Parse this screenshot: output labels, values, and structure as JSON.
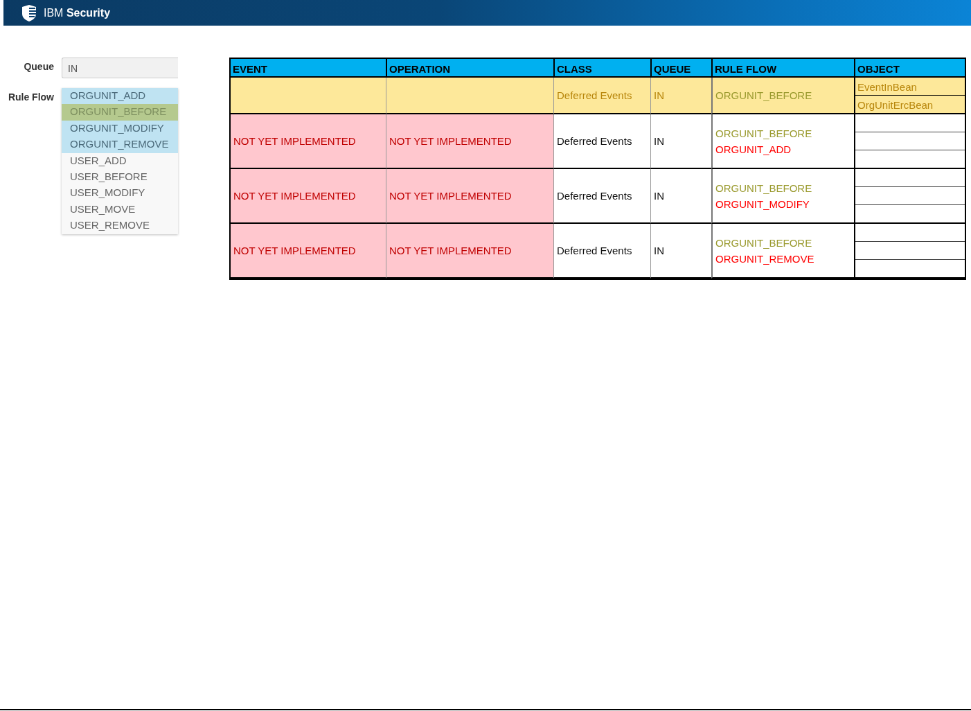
{
  "header": {
    "brand": "IBM **Security**"
  },
  "form": {
    "queue": {
      "label": "Queue",
      "value": "IN"
    },
    "rule_flow": {
      "label": "Rule Flow",
      "options": [
        {
          "label": "ORGUNIT_ADD",
          "selected": true,
          "active": false
        },
        {
          "label": "ORGUNIT_BEFORE",
          "selected": true,
          "active": true
        },
        {
          "label": "ORGUNIT_MODIFY",
          "selected": true,
          "active": false
        },
        {
          "label": "ORGUNIT_REMOVE",
          "selected": true,
          "active": false
        },
        {
          "label": "USER_ADD",
          "selected": false,
          "active": false
        },
        {
          "label": "USER_BEFORE",
          "selected": false,
          "active": false
        },
        {
          "label": "USER_MODIFY",
          "selected": false,
          "active": false
        },
        {
          "label": "USER_MOVE",
          "selected": false,
          "active": false
        },
        {
          "label": "USER_REMOVE",
          "selected": false,
          "active": false
        }
      ]
    }
  },
  "table": {
    "columns": [
      "EVENT",
      "OPERATION",
      "CLASS",
      "QUEUE",
      "RULE FLOW",
      "OBJECT"
    ],
    "rows": [
      {
        "kind": "configured",
        "class": "Deferred Events",
        "queue": "IN",
        "rule_flow": [
          {
            "kind": "base",
            "text": "ORGUNIT_BEFORE"
          }
        ],
        "objects": [
          {
            "text": "EventInBean"
          },
          {
            "text": "OrgUnitErcBean"
          }
        ]
      },
      {
        "kind": "pending",
        "event": "NOT YET IMPLEMENTED",
        "operation": "NOT YET IMPLEMENTED",
        "class": "Deferred Events",
        "queue": "IN",
        "rule_flow": [
          {
            "kind": "base",
            "text": "ORGUNIT_BEFORE"
          },
          {
            "kind": "target",
            "text": "ORGUNIT_ADD"
          }
        ],
        "blank_objects": true
      },
      {
        "kind": "pending",
        "event": "NOT YET IMPLEMENTED",
        "operation": "NOT YET IMPLEMENTED",
        "class": "Deferred Events",
        "queue": "IN",
        "rule_flow": [
          {
            "kind": "base",
            "text": "ORGUNIT_BEFORE"
          },
          {
            "kind": "target",
            "text": "ORGUNIT_MODIFY"
          }
        ],
        "blank_objects": true
      },
      {
        "kind": "pending",
        "event": "NOT YET IMPLEMENTED",
        "operation": "NOT YET IMPLEMENTED",
        "class": "Deferred Events",
        "queue": "IN",
        "rule_flow": [
          {
            "kind": "base",
            "text": "ORGUNIT_BEFORE"
          },
          {
            "kind": "target",
            "text": "ORGUNIT_REMOVE"
          }
        ],
        "blank_objects": true
      }
    ]
  }
}
